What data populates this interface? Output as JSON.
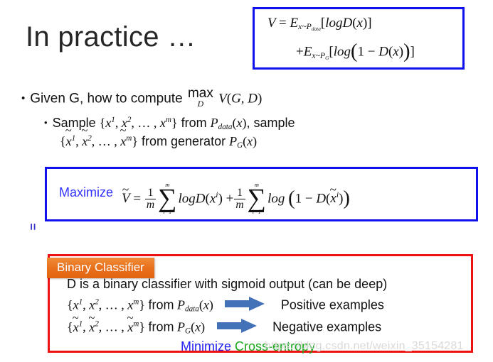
{
  "slide": {
    "title": "In practice …"
  },
  "objective_box": {
    "border_color": "#1111ee",
    "line1": {
      "V": "V",
      "equals": "=",
      "E": "E",
      "sub": "x~P",
      "sub_sub": "data",
      "bracket_open": "[",
      "log": "log",
      "D": "D",
      "paren_open": "(",
      "x": "x",
      "paren_close": ")",
      "bracket_close": "]"
    },
    "line2": {
      "plus": "+",
      "E": "E",
      "sub": "x~P",
      "sub_sub": "G",
      "bracket_open": "[",
      "log": "log",
      "paren_open": "(",
      "one": "1",
      "minus": "−",
      "D": "D",
      "inner_open": "(",
      "x": "x",
      "inner_close": ")",
      "paren_close": ")",
      "bracket_close": "]"
    }
  },
  "bullets": {
    "bullet_marker": "•",
    "sub_bullet_marker": "•",
    "level1": {
      "text_before": "Given G, how to compute",
      "max_op": "max",
      "max_under": "D",
      "V": "V",
      "paren_open": "(",
      "G": "G",
      "comma": ", ",
      "D": "D",
      "paren_close": ")"
    },
    "level2_line1": {
      "sample": "Sample",
      "brace_open": "{",
      "x": "x",
      "sup1": "1",
      "sup2": "2",
      "dots": ", … , ",
      "supm": "m",
      "brace_close": "}",
      "from": "from",
      "P": "P",
      "sub": "data",
      "paren_open": "(",
      "arg": "x",
      "paren_close": ")",
      "trailing": ", sample"
    },
    "level2_line2": {
      "brace_open": "{",
      "x": "x",
      "tilde": "~",
      "sup1": "1",
      "sup2": "2",
      "dots": ", … , ",
      "supm": "m",
      "brace_close": "}",
      "from_generator": "from generator",
      "P": "P",
      "sub": "G",
      "paren_open": "(",
      "arg": "x",
      "paren_close": ")"
    }
  },
  "maximize_box": {
    "border_color": "#1111ee",
    "label": "Maximize",
    "label_color": "#3333ff",
    "formula": {
      "Vtilde": "V",
      "tilde": "~",
      "equals": "=",
      "frac_num": "1",
      "frac_den": "m",
      "sum_upper": "m",
      "sum_glyph": "∑",
      "sum_lower": "i=1",
      "log": "log",
      "D": "D",
      "paren_open": "(",
      "x": "x",
      "sup_i": "i",
      "paren_close": ")",
      "plus": "+",
      "one": "1",
      "minus": "−",
      "xt": "x"
    }
  },
  "equals_mark": {
    "symbol": "=",
    "color": "#3a33cc"
  },
  "classifier_box": {
    "border_color": "#ee1111",
    "badge": {
      "label": "Binary Classifier",
      "bg_start": "#f08c38",
      "bg_end": "#e2650f",
      "text_color": "#ffffff"
    },
    "description": "D is a binary classifier with sigmoid output (can be deep)",
    "positive_row": {
      "brace_open": "{",
      "x": "x",
      "sup1": "1",
      "sup2": "2",
      "dots": ", … , ",
      "supm": "m",
      "brace_close": "}",
      "from": "from",
      "P": "P",
      "sub": "data",
      "paren_open": "(",
      "arg": "x",
      "paren_close": ")",
      "arrow": "right-arrow-icon",
      "arrow_color": "#4472b8",
      "label": "Positive examples"
    },
    "negative_row": {
      "brace_open": "{",
      "x": "x",
      "tilde": "~",
      "sup1": "1",
      "sup2": "2",
      "dots": ", … , ",
      "supm": "m",
      "brace_close": "}",
      "from": "from",
      "P": "P",
      "sub": "G",
      "paren_open": "(",
      "arg": "x",
      "paren_close": ")",
      "arrow": "right-arrow-icon",
      "arrow_color": "#4472b8",
      "label": "Negative examples"
    },
    "minimize": {
      "word": "Minimize",
      "word_color": "#2222ee",
      "target": "Cross-entropy",
      "target_color": "#1aa81a"
    }
  },
  "watermark": {
    "text": "https://blog.csdn.net/weixin_35154281",
    "color": "#d9d9d9"
  }
}
